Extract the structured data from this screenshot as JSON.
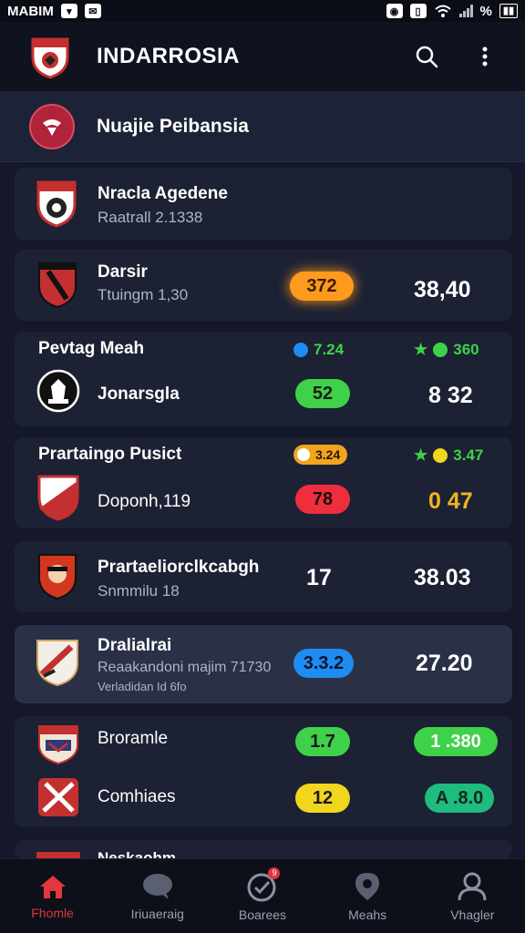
{
  "status_bar": {
    "left_text": "MABIM",
    "battery": "%"
  },
  "app_bar": {
    "title": "INDARROSIA"
  },
  "featured": {
    "title": "Nuajie Peibansia"
  },
  "matches": [
    {
      "team": "Nracla Agedene",
      "info": "Raatrall 2.1338"
    },
    {
      "team": "Darsir",
      "info": "Ttuingm 1,30",
      "odds": "372",
      "score": "38,40"
    },
    {
      "section": "Pevtag Meah",
      "left_stat": "7.24",
      "right_stat": "360",
      "team": "Jonarsgla",
      "odds": "52",
      "score": "8 32"
    },
    {
      "section": "Prartaingo Pusict",
      "left_stat": "3.24",
      "right_stat": "3.47",
      "team": "Doponh,119",
      "odds": "78",
      "score": "0 47"
    },
    {
      "team": "Prartaeliorclkcabgh",
      "info": "Snmmilu 18",
      "odds": "17",
      "score": "38.03"
    },
    {
      "team": "Dralialrai",
      "info": "Reaakandoni majim 71730",
      "info2": "Verladidan Id 6fo",
      "odds": "3.3.2",
      "score": "27.20"
    },
    {
      "team": "Broramle",
      "odds": "1.7",
      "score": "1 .380",
      "team2": "Comhiaes",
      "odds2": "12",
      "score2": "A .8.0"
    },
    {
      "team": "Neskaohm"
    }
  ],
  "nav": {
    "items": [
      {
        "label": "Fhomle",
        "icon": "home-icon"
      },
      {
        "label": "Iriuaeraig",
        "icon": "chat-icon"
      },
      {
        "label": "Boarees",
        "icon": "check-circle-icon"
      },
      {
        "label": "Meahs",
        "icon": "pin-icon"
      },
      {
        "label": "Vhagler",
        "icon": "user-icon"
      }
    ]
  },
  "colors": {
    "accent": "#e0383c",
    "green": "#3fd14a",
    "red": "#ee2e3c",
    "yellow": "#f1d61f",
    "blue": "#1e8cf0",
    "orange": "#ff9a1c"
  }
}
